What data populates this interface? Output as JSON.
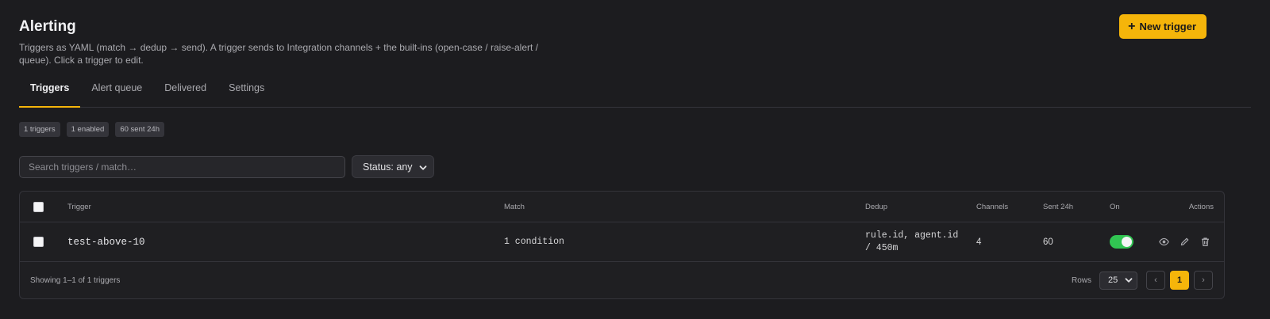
{
  "header": {
    "title": "Alerting",
    "description": "Triggers as YAML (match → dedup → send). A trigger sends to Integration channels + the built-ins (open-case / raise-alert / queue). Click a trigger to edit.",
    "new_trigger_label": "New trigger"
  },
  "tabs": [
    {
      "label": "Triggers",
      "active": true
    },
    {
      "label": "Alert queue",
      "active": false
    },
    {
      "label": "Delivered",
      "active": false
    },
    {
      "label": "Settings",
      "active": false
    }
  ],
  "badges": [
    "1 triggers",
    "1 enabled",
    "60 sent 24h"
  ],
  "filters": {
    "search_placeholder": "Search triggers / match…",
    "status_label": "Status: any"
  },
  "table": {
    "columns": {
      "trigger": "Trigger",
      "match": "Match",
      "dedup": "Dedup",
      "channels": "Channels",
      "sent_24h": "Sent 24h",
      "on": "On",
      "actions": "Actions"
    },
    "rows": [
      {
        "trigger": "test-above-10",
        "match": "1 condition",
        "dedup": "rule.id, agent.id\n/ 450m",
        "channels": "4",
        "sent_24h": "60",
        "enabled": true
      }
    ]
  },
  "footer": {
    "showing": "Showing 1–1 of 1 triggers",
    "rows_label": "Rows",
    "rows_value": "25",
    "prev": "‹",
    "current_page": "1",
    "next": "›"
  },
  "colors": {
    "accent": "#f5b50a",
    "toggle_on": "#31c452",
    "background": "#1c1c1f"
  }
}
